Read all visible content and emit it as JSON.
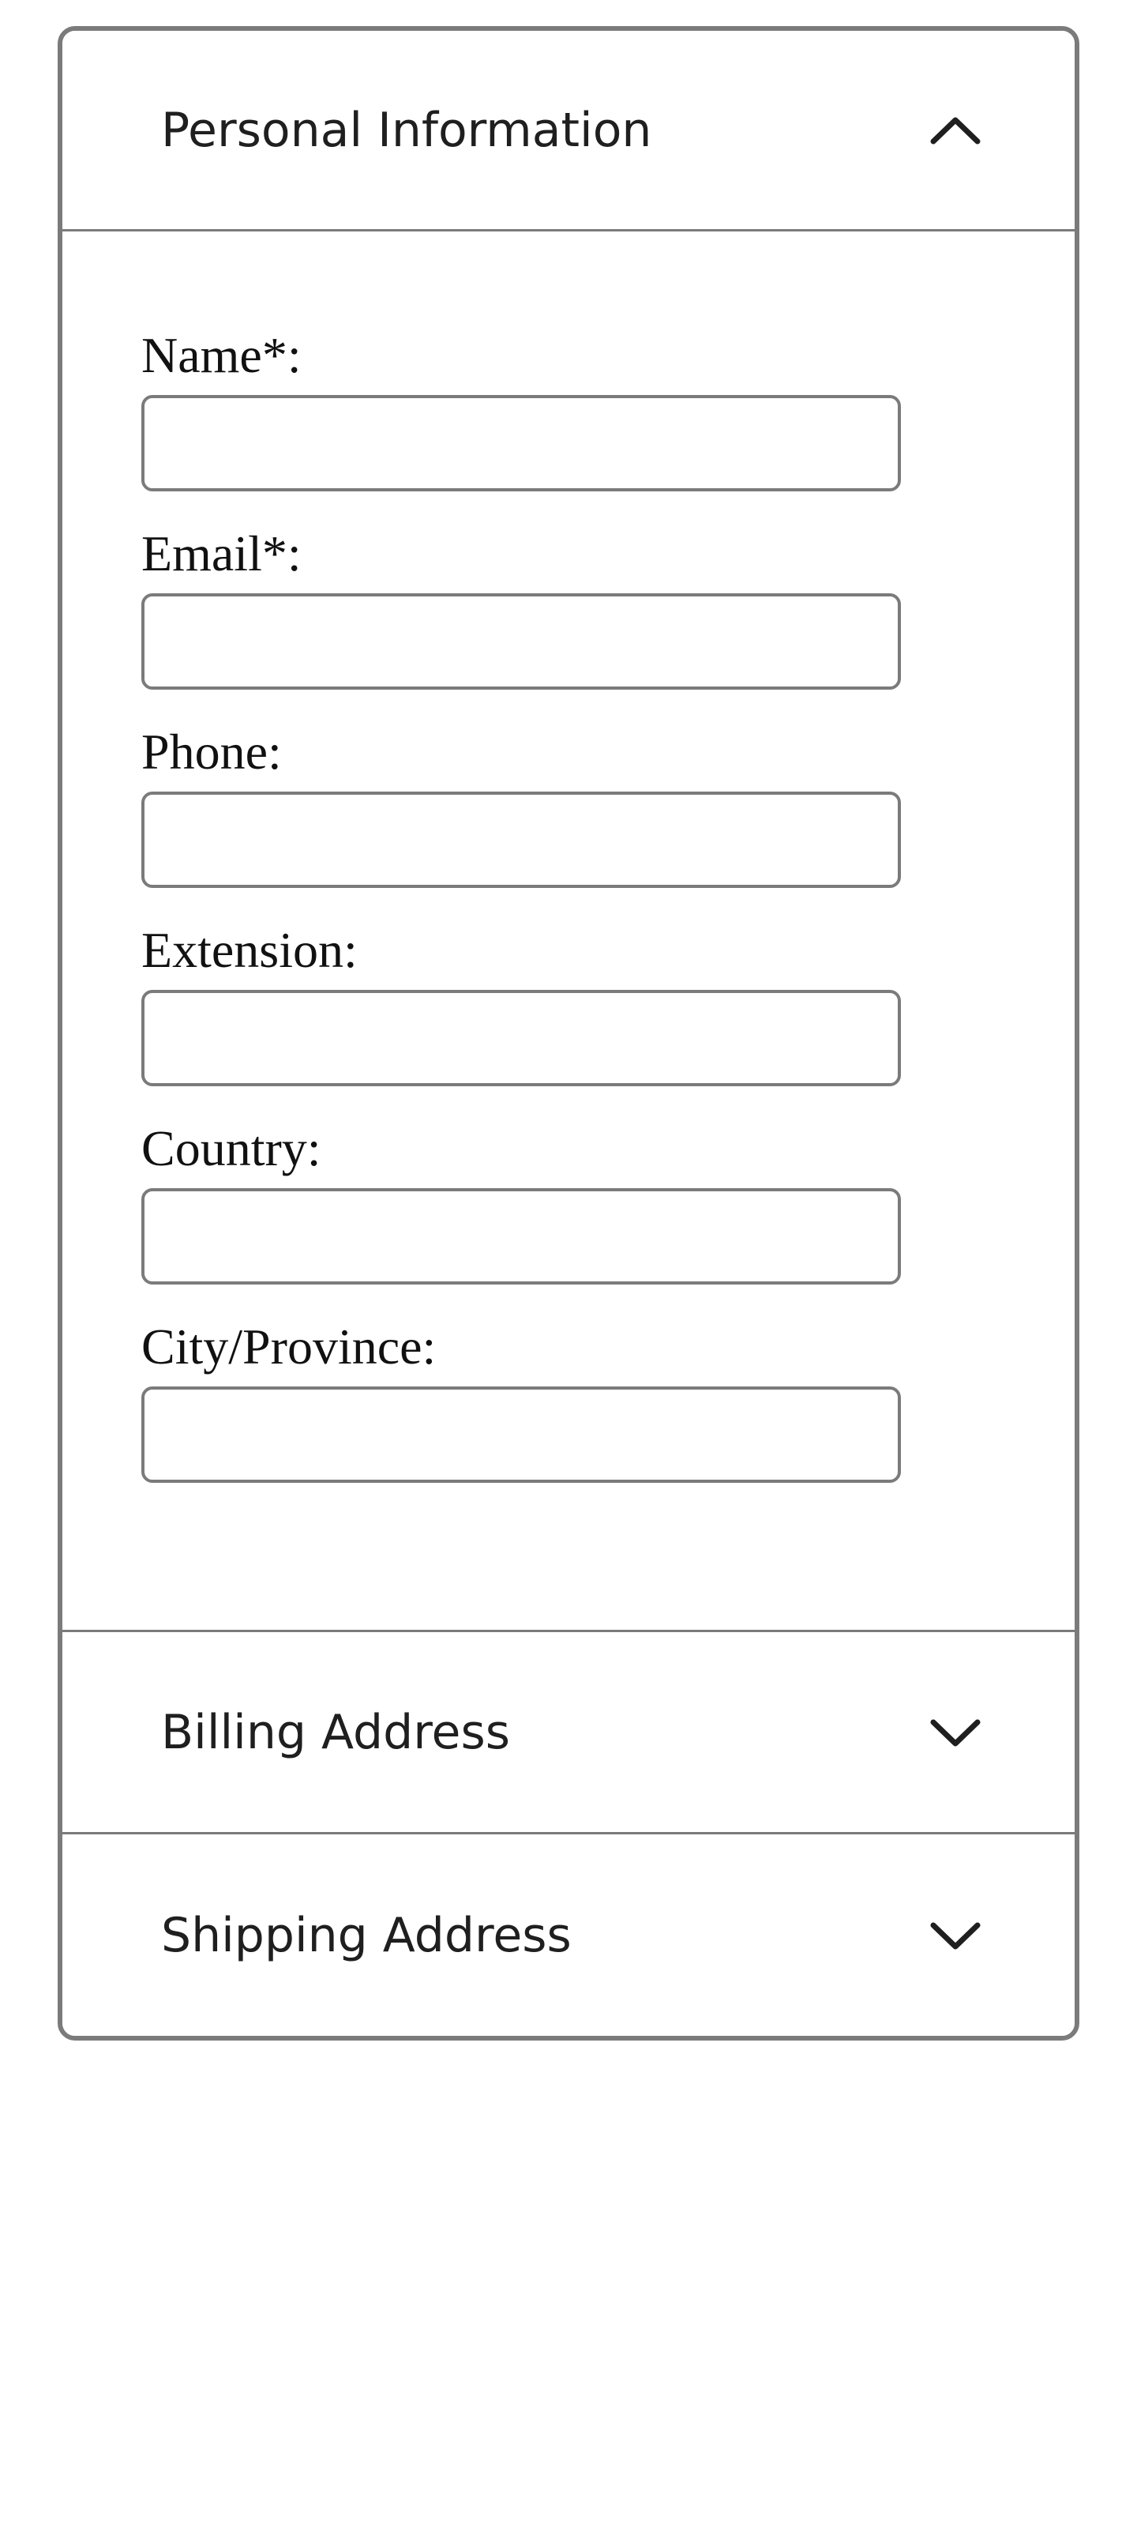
{
  "accordion": {
    "personal": {
      "title": "Personal Information",
      "chevron_icon": "chevron-up-icon",
      "expanded": true,
      "fields": [
        {
          "label": "Name*:",
          "value": "",
          "placeholder": ""
        },
        {
          "label": "Email*:",
          "value": "",
          "placeholder": ""
        },
        {
          "label": "Phone:",
          "value": "",
          "placeholder": ""
        },
        {
          "label": "Extension:",
          "value": "",
          "placeholder": ""
        },
        {
          "label": "Country:",
          "value": "",
          "placeholder": ""
        },
        {
          "label": "City/Province:",
          "value": "",
          "placeholder": ""
        }
      ]
    },
    "billing": {
      "title": "Billing Address",
      "chevron_icon": "chevron-down-icon",
      "expanded": false
    },
    "shipping": {
      "title": "Shipping Address",
      "chevron_icon": "chevron-down-icon",
      "expanded": false
    }
  },
  "colors": {
    "border": "#7b7b7b",
    "text": "#1f1f1f",
    "background": "#ffffff"
  }
}
